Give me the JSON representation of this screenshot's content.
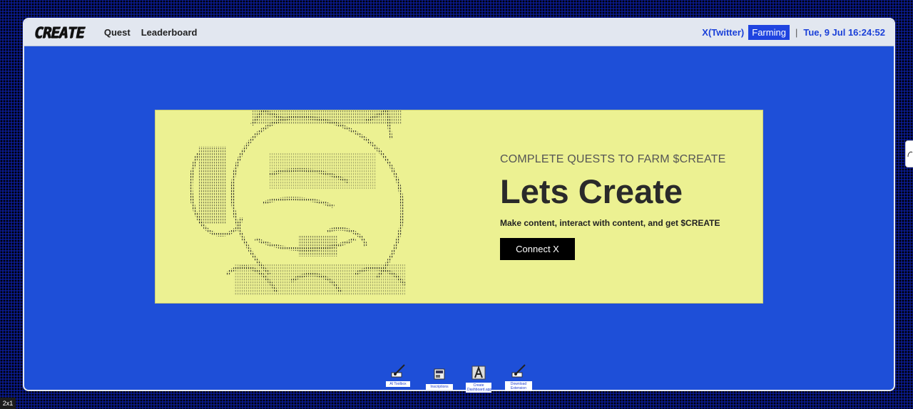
{
  "header": {
    "logo_text": "CREATE",
    "nav": [
      {
        "label": "Quest"
      },
      {
        "label": "Leaderboard"
      }
    ],
    "social_link": "X(Twitter)",
    "farming_button": "Farming",
    "separator": "|",
    "clock": "Tue, 9 Jul 16:24:52"
  },
  "hero": {
    "kicker": "COMPLETE QUESTS TO FARM $CREATE",
    "title": "Lets Create",
    "description": "Make content, interact with content, and get $CREATE",
    "cta": "Connect X"
  },
  "desktop_icons": [
    {
      "label": "AI Toolbox",
      "icon": "paintbrush-icon"
    },
    {
      "label": "Inscriptions",
      "icon": "notepad-icon"
    },
    {
      "label": "Create Dashboard.app",
      "icon": "app-a-icon"
    },
    {
      "label": "Download Extension",
      "icon": "paintbrush-icon"
    }
  ],
  "corner_badge": "2x1",
  "colors": {
    "desktop_bg": "#0a1a8c",
    "window_bg": "#1e4fd8",
    "hero_bg": "#ecf192",
    "accent": "#1f44e0",
    "cta_bg": "#000000"
  }
}
